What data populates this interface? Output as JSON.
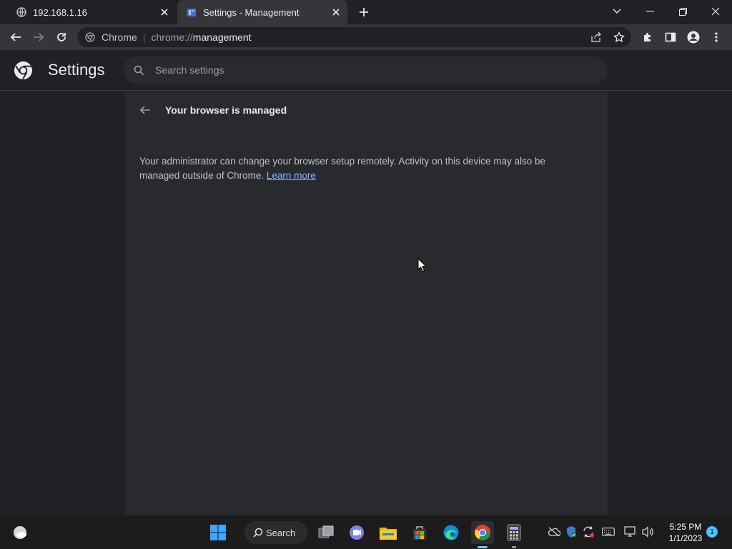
{
  "tabs": [
    {
      "title": "192.168.1.16",
      "icon": "globe-icon"
    },
    {
      "title": "Settings - Management",
      "icon": "settings-page-icon"
    }
  ],
  "omnibox": {
    "chip_label": "Chrome",
    "url_scheme": "chrome://",
    "url_host": "management"
  },
  "settings": {
    "title": "Settings",
    "search_placeholder": "Search settings"
  },
  "management": {
    "heading": "Your browser is managed",
    "description": "Your administrator can change your browser setup remotely. Activity on this device may also be managed outside of Chrome.",
    "learn_more": "Learn more"
  },
  "taskbar": {
    "search_label": "Search",
    "time": "5:25 PM",
    "date": "1/1/2023",
    "notification_count": "1"
  },
  "colors": {
    "accent_link": "#8ab4f8",
    "taskbar_indicator": "#60cdff"
  }
}
